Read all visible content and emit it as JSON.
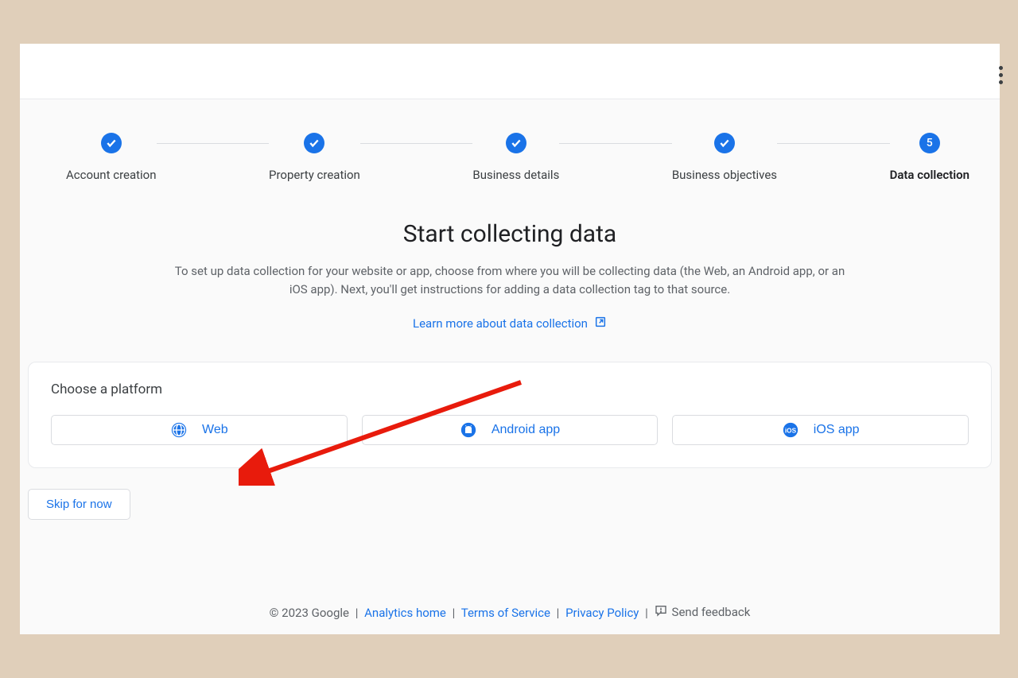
{
  "stepper": {
    "steps": [
      {
        "label": "Account creation",
        "state": "done"
      },
      {
        "label": "Property creation",
        "state": "done"
      },
      {
        "label": "Business details",
        "state": "done"
      },
      {
        "label": "Business objectives",
        "state": "done"
      },
      {
        "label": "Data collection",
        "state": "current",
        "number": "5"
      }
    ]
  },
  "content": {
    "heading": "Start collecting data",
    "description": "To set up data collection for your website or app, choose from where you will be collecting data (the Web, an Android app, or an iOS app). Next, you'll get instructions for adding a data collection tag to that source.",
    "learn_more": "Learn more about data collection"
  },
  "platform": {
    "title": "Choose a platform",
    "options": {
      "web": "Web",
      "android": "Android app",
      "ios": "iOS app"
    }
  },
  "actions": {
    "skip": "Skip for now"
  },
  "footer": {
    "copyright": "© 2023 Google",
    "links": {
      "analytics_home": "Analytics home",
      "terms": "Terms of Service",
      "privacy": "Privacy Policy"
    },
    "feedback": "Send feedback"
  }
}
